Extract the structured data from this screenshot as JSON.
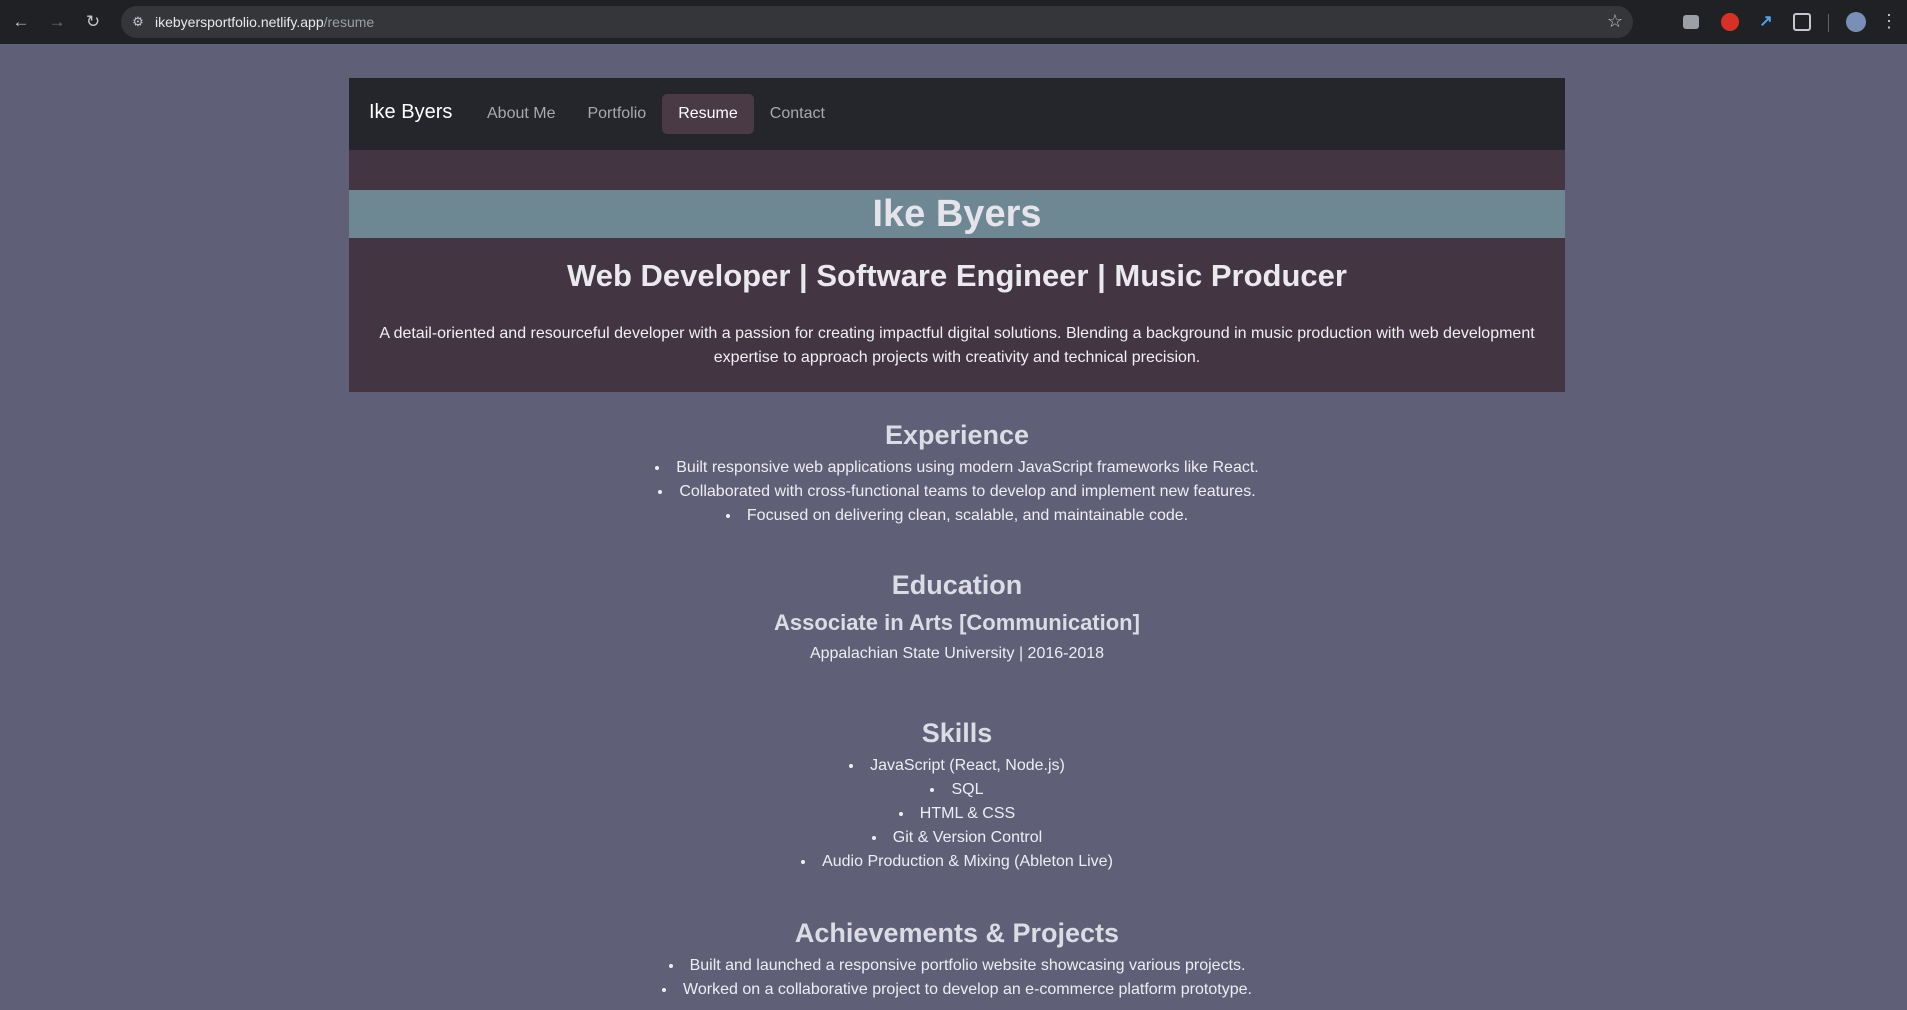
{
  "browser": {
    "url_host": "ikebyersportfolio.netlify.app",
    "url_path": "/resume"
  },
  "navbar": {
    "brand": "Ike Byers",
    "links": [
      {
        "label": "About Me",
        "active": false
      },
      {
        "label": "Portfolio",
        "active": false
      },
      {
        "label": "Resume",
        "active": true
      },
      {
        "label": "Contact",
        "active": false
      }
    ]
  },
  "hero": {
    "name": "Ike Byers",
    "title": "Web Developer | Software Engineer | Music Producer",
    "summary": "A detail-oriented and resourceful developer with a passion for creating impactful digital solutions. Blending a background in music production with web development expertise to approach projects with creativity and technical precision."
  },
  "experience": {
    "heading": "Experience",
    "items": [
      "Built responsive web applications using modern JavaScript frameworks like React.",
      "Collaborated with cross-functional teams to develop and implement new features.",
      "Focused on delivering clean, scalable, and maintainable code."
    ]
  },
  "education": {
    "heading": "Education",
    "degree": "Associate in Arts [Communication]",
    "school": "Appalachian State University | 2016-2018"
  },
  "skills": {
    "heading": "Skills",
    "items": [
      "JavaScript (React, Node.js)",
      "SQL",
      "HTML & CSS",
      "Git & Version Control",
      "Audio Production & Mixing (Ableton Live)"
    ]
  },
  "achievements": {
    "heading": "Achievements & Projects",
    "items": [
      "Built and launched a responsive portfolio website showcasing various projects.",
      "Worked on a collaborative project to develop an e-commerce platform prototype."
    ]
  }
}
